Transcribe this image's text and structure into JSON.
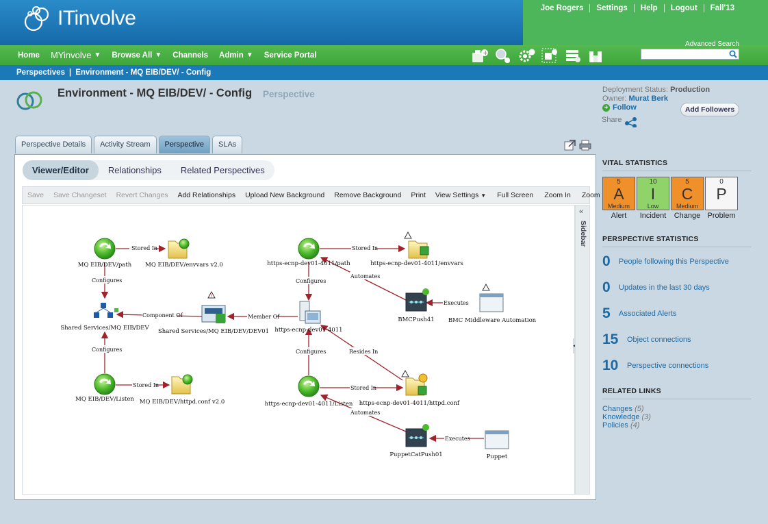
{
  "app": {
    "logo_text": "ITinvolve"
  },
  "user_nav": [
    {
      "label": "Joe Rogers"
    },
    {
      "label": "Settings"
    },
    {
      "label": "Help"
    },
    {
      "label": "Logout"
    },
    {
      "label": "Fall'13"
    }
  ],
  "main_nav": [
    {
      "label": "Home",
      "dropdown": false
    },
    {
      "label": "MYinvolve",
      "dropdown": true
    },
    {
      "label": "Browse All",
      "dropdown": true
    },
    {
      "label": "Channels",
      "dropdown": false
    },
    {
      "label": "Admin",
      "dropdown": true
    },
    {
      "label": "Service Portal",
      "dropdown": false
    }
  ],
  "search": {
    "label": "Advanced Search",
    "value": "",
    "placeholder": ""
  },
  "breadcrumb": {
    "root": "Perspectives",
    "separator": "|",
    "current": "Environment - MQ EIB/DEV/ - Config"
  },
  "page": {
    "title": "Environment - MQ EIB/DEV/ - Config",
    "type": "Perspective",
    "deployment_label": "Deployment Status:",
    "deployment_value": "Production",
    "owner_label": "Owner:",
    "owner_value": "Murat Berk",
    "follow": "Follow",
    "share": "Share",
    "add_followers": "Add Followers"
  },
  "tabs": [
    {
      "label": "Perspective Details",
      "active": false
    },
    {
      "label": "Activity Stream",
      "active": false
    },
    {
      "label": "Perspective",
      "active": true
    },
    {
      "label": "SLAs",
      "active": false
    }
  ],
  "subtabs": [
    {
      "label": "Viewer/Editor",
      "active": true
    },
    {
      "label": "Relationships",
      "active": false
    },
    {
      "label": "Related Perspectives",
      "active": false
    }
  ],
  "toolbar": {
    "save": "Save",
    "save_changeset": "Save Changeset",
    "revert": "Revert Changes",
    "add_relationships": "Add Relationships",
    "upload_bg": "Upload New Background",
    "remove_bg": "Remove Background",
    "print": "Print",
    "view_settings": "View Settings",
    "full_screen": "Full Screen",
    "zoom_in": "Zoom In",
    "zoom_out": "Zoom Out"
  },
  "sidebar_label": "Sidebar",
  "diagram": {
    "nodes": {
      "mq_path": "MQ EIB/DEV/path",
      "mq_envvars": "MQ EIB/DEV/envvars v2.0",
      "shared_services": "Shared Services/MQ EIB/DEV",
      "shared_dev01": "Shared Services/MQ EIB/DEV/DEV01",
      "mq_listen": "MQ EIB/DEV/Listen",
      "mq_httpd": "MQ EIB/DEV/httpd.conf v2.0",
      "https_path": "https-ecnp-dev01-4011/path",
      "https_envvars": "https-ecnp-dev01-4011/envvars",
      "https_server": "https-ecnp-dev01-4011",
      "bmc_push": "BMCPush41",
      "bmc_auto": "BMC Middleware Automation",
      "https_listen": "https-ecnp-dev01-4011/Listen",
      "https_httpd": "https-ecnp-dev01-4011/httpd.conf",
      "puppet_push": "PuppetCatPush01",
      "puppet": "Puppet"
    },
    "edges": {
      "stored_in": "Stored In",
      "configures": "Configures",
      "component_of": "Component Of",
      "member_of": "Member Of",
      "resides_in": "Resides In",
      "automates": "Automates",
      "executes": "Executes"
    }
  },
  "vital": {
    "title": "VITAL STATISTICS",
    "items": [
      {
        "count": "5",
        "letter": "A",
        "severity": "Medium",
        "label": "Alert",
        "color": "#f0902a"
      },
      {
        "count": "10",
        "letter": "I",
        "severity": "Low",
        "label": "Incident",
        "color": "#8fd36a"
      },
      {
        "count": "5",
        "letter": "C",
        "severity": "Medium",
        "label": "Change",
        "color": "#f0902a"
      },
      {
        "count": "0",
        "letter": "P",
        "severity": "",
        "label": "Problem",
        "color": "#f6f6f6"
      }
    ]
  },
  "pstats": {
    "title": "PERSPECTIVE STATISTICS",
    "items": [
      {
        "num": "0",
        "text": "People following this Perspective"
      },
      {
        "num": "0",
        "text": "Updates in the last 30 days"
      },
      {
        "num": "5",
        "text": "Associated Alerts"
      },
      {
        "num": "15",
        "text": "Object connections"
      },
      {
        "num": "10",
        "text": "Perspective connections"
      }
    ]
  },
  "related": {
    "title": "RELATED LINKS",
    "items": [
      {
        "label": "Changes",
        "count": "(5)"
      },
      {
        "label": "Knowledge",
        "count": "(3)"
      },
      {
        "label": "Policies",
        "count": "(4)"
      }
    ]
  },
  "colors": {
    "brand_blue": "#1c79b8",
    "brand_green": "#4db65a",
    "link": "#1b6aa5",
    "edge": "#a0232b"
  }
}
